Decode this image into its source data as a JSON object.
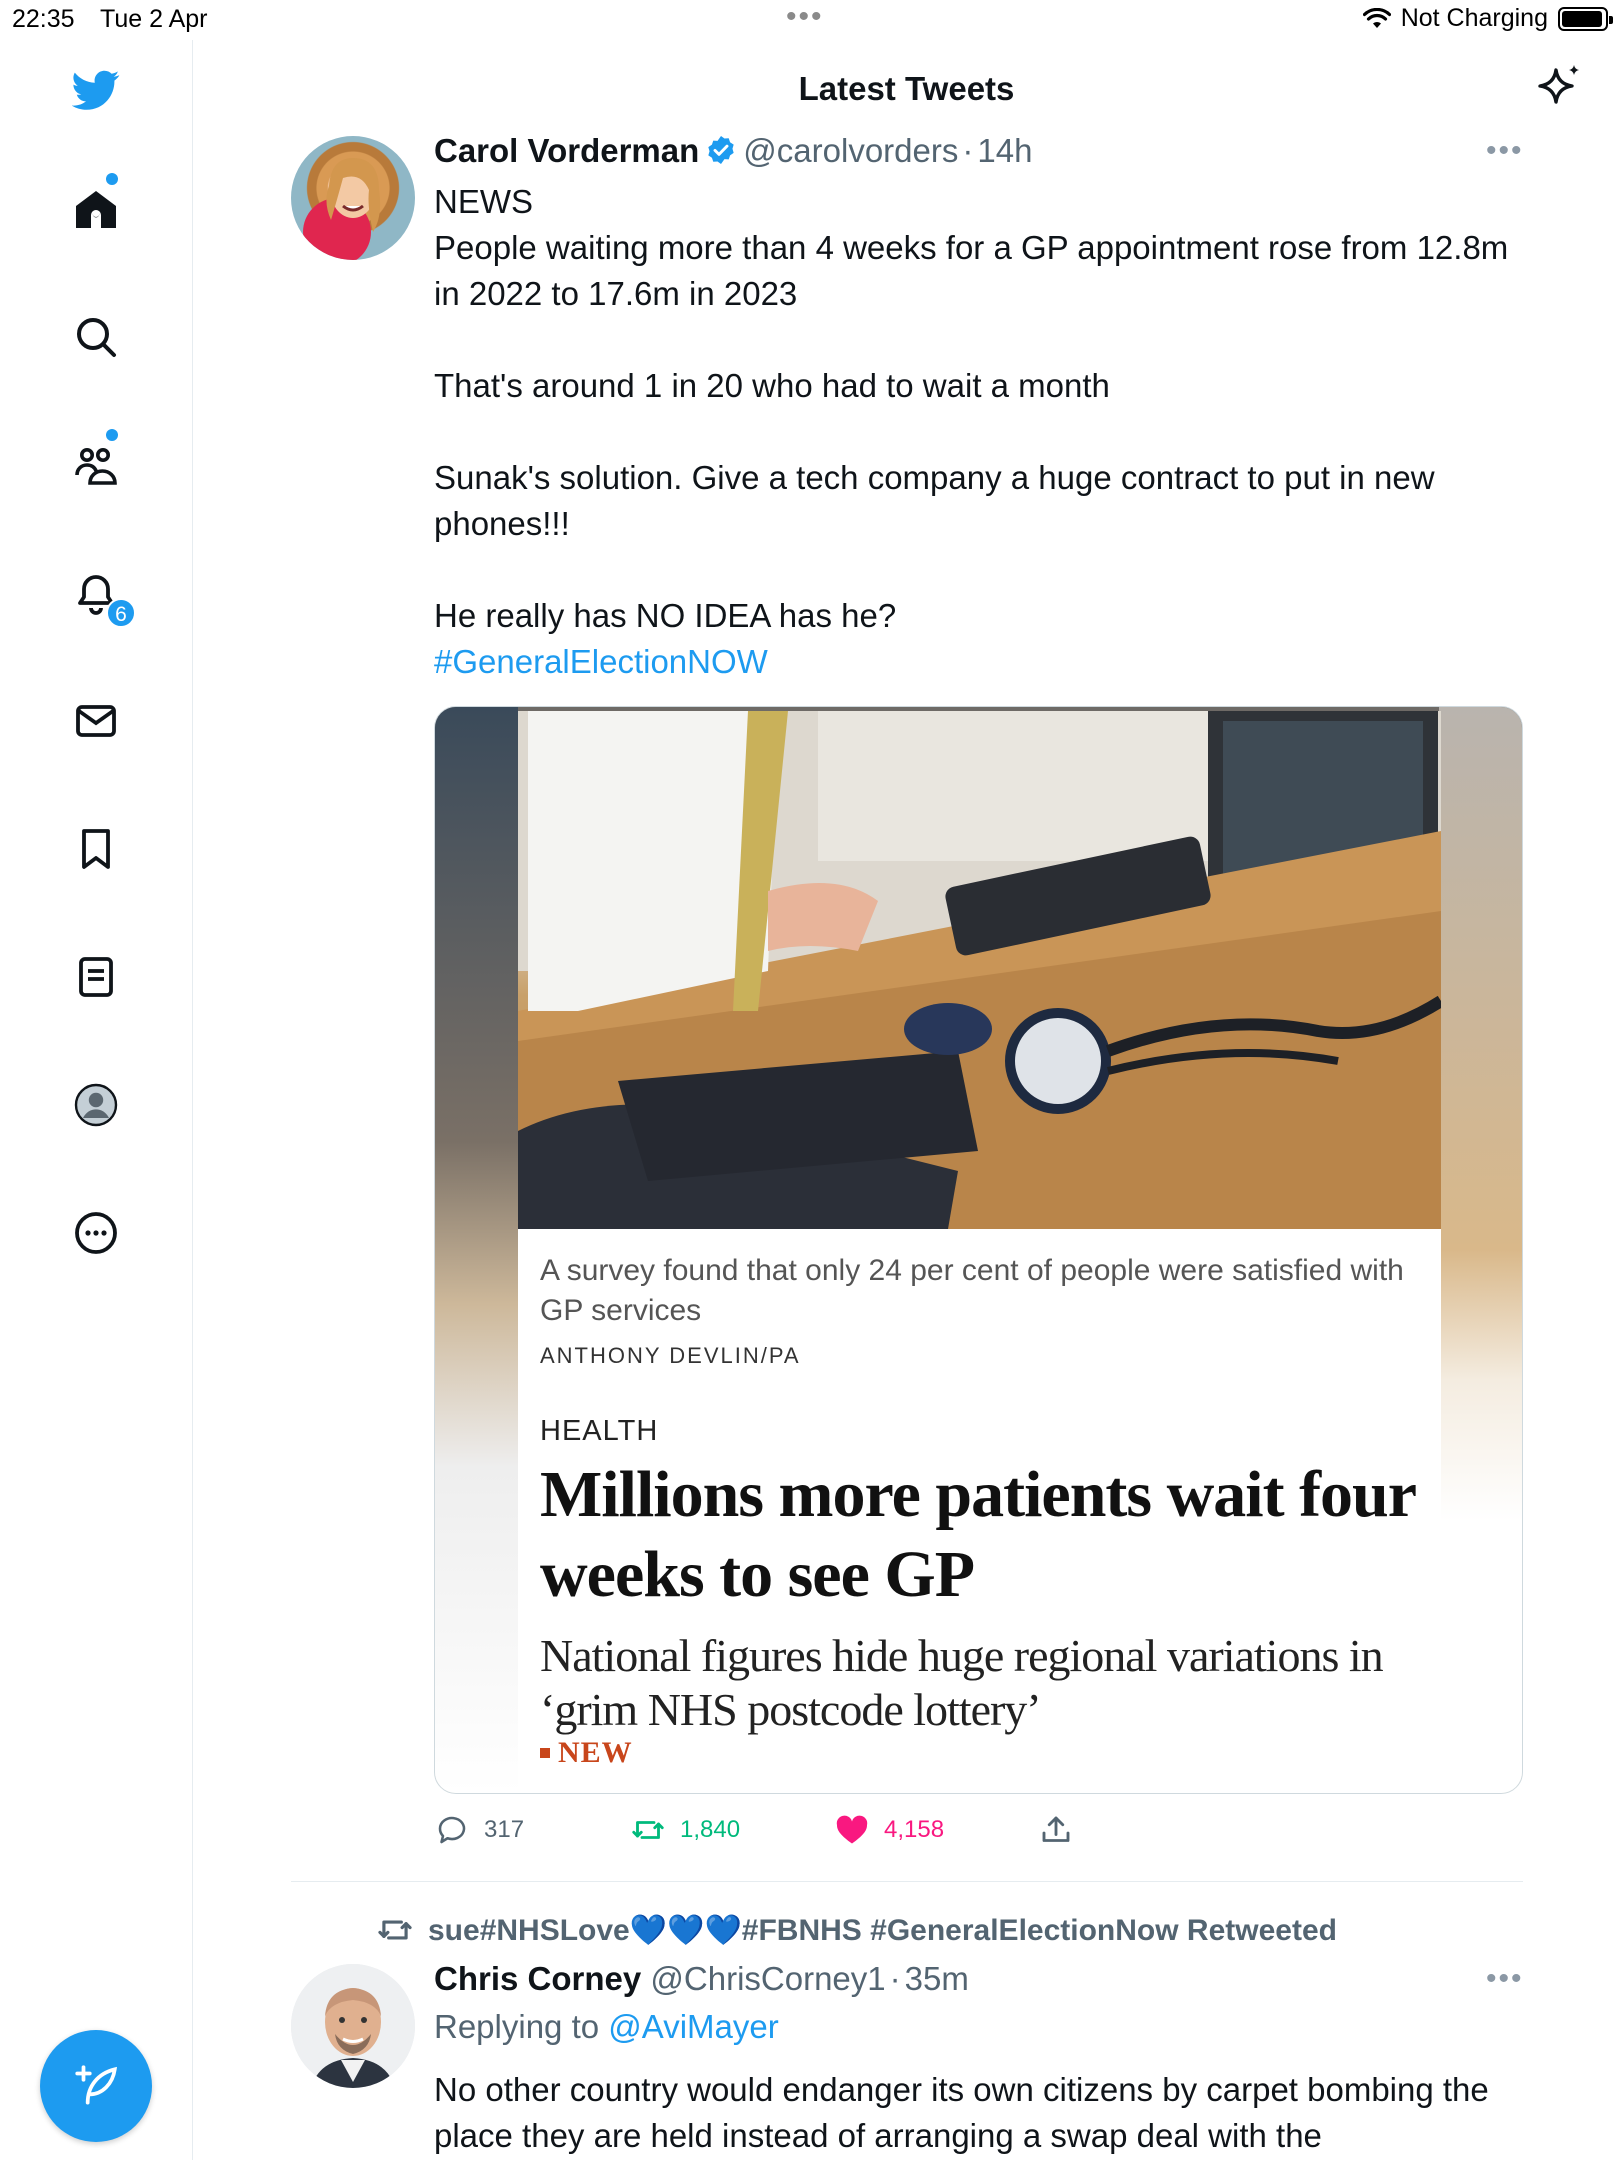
{
  "status_bar": {
    "time": "22:35",
    "date": "Tue 2 Apr",
    "dots": "•••",
    "charging": "Not Charging"
  },
  "sidebar": {
    "items": [
      {
        "name": "home",
        "icon": "home-icon",
        "has_dot": true
      },
      {
        "name": "explore",
        "icon": "search-icon"
      },
      {
        "name": "communities",
        "icon": "communities-icon",
        "has_dot": true
      },
      {
        "name": "notifications",
        "icon": "bell-icon",
        "badge": "6"
      },
      {
        "name": "messages",
        "icon": "mail-icon"
      },
      {
        "name": "bookmarks",
        "icon": "bookmark-icon"
      },
      {
        "name": "lists",
        "icon": "list-icon"
      },
      {
        "name": "profile",
        "icon": "profile-icon"
      },
      {
        "name": "more",
        "icon": "more-circle-icon"
      }
    ],
    "accent": "#1d9bf0"
  },
  "header": {
    "title": "Latest Tweets"
  },
  "tweets": [
    {
      "name": "Carol Vorderman",
      "handle": "@carolvorders",
      "sep": "·",
      "time": "14h",
      "text": {
        "line1": "NEWS",
        "line2": "People waiting more than 4 weeks for a GP appointment rose from 12.8m in 2022 to 17.6m in 2023",
        "line3": "That's around 1 in 20 who had to wait a month",
        "line4": "Sunak's solution.  Give a tech company a huge contract to put in new phones!!!",
        "line5": "He really has NO IDEA has he?",
        "hashtag": "#GeneralElectionNOW"
      },
      "card": {
        "caption": "A survey found that only 24 per cent of people were satisfied with GP services",
        "credit": "ANTHONY DEVLIN/PA",
        "section": "HEALTH",
        "headline": "Millions more patients wait four weeks to see GP",
        "subhead": "National figures hide huge regional variations in ‘grim NHS postcode lottery’",
        "tag": "NEW"
      },
      "stats": {
        "replies": "317",
        "retweets": "1,840",
        "likes": "4,158"
      },
      "colors": {
        "retweet": "#00ba7c",
        "like": "#f91880"
      }
    },
    {
      "retweeted_by": "sue#NHSLove💙💙💙#FBNHS #GeneralElectionNow Retweeted",
      "name": "Chris Corney",
      "handle": "@ChrisCorney1",
      "sep": "·",
      "time": "35m",
      "replying_prefix": "Replying to",
      "replying_to": "@AviMayer",
      "text": "No other country would endanger its own citizens by carpet bombing the place they are held instead of arranging a swap deal with the"
    }
  ]
}
